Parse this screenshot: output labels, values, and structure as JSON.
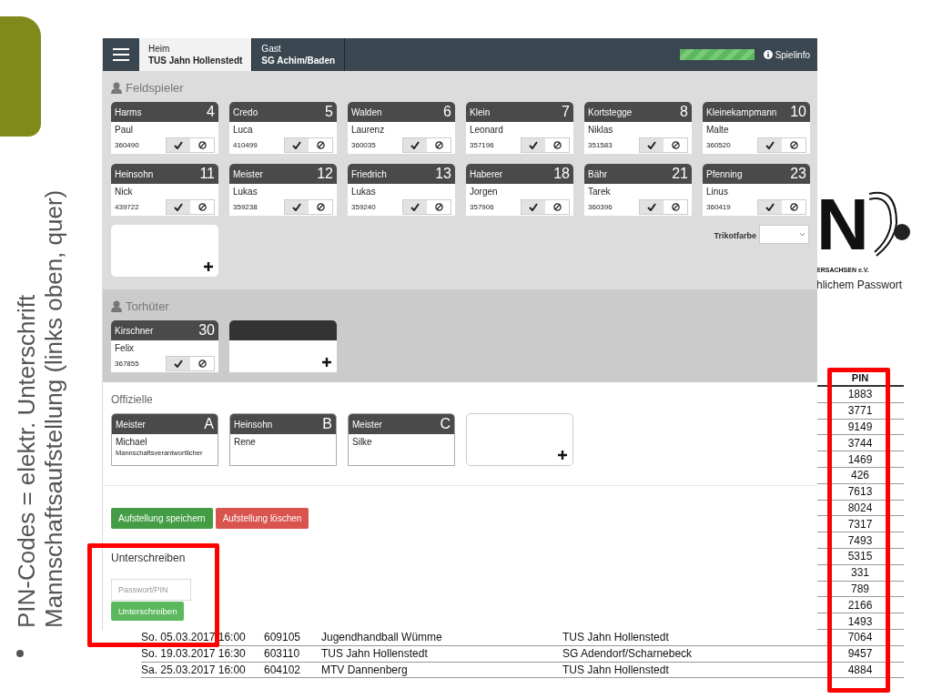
{
  "slide": {
    "bullet": "PIN-Codes = elektr. Unterschrift Mannschaftsaufstellung (links oben, quer)"
  },
  "document": {
    "logo_letter": "N",
    "logo_caption": "ERSACHSEN e.V.",
    "note": "hlichem Passwort",
    "pin_header": "PIN",
    "rows": [
      {
        "pin": "1883"
      },
      {
        "pin": "3771"
      },
      {
        "pin": "9149"
      },
      {
        "pin": "3744"
      },
      {
        "pin": "1469"
      },
      {
        "pin": "426"
      },
      {
        "pin": "7613"
      },
      {
        "pin": "8024"
      },
      {
        "pin": "7317"
      },
      {
        "pin": "7493"
      },
      {
        "pin": "5315"
      },
      {
        "pin": "331"
      },
      {
        "pin": "789"
      },
      {
        "pin": "2166"
      },
      {
        "pin": "1493"
      },
      {
        "date": "So. 05.03.2017 16:00",
        "number": "609105",
        "home": "Jugendhandball Wümme",
        "away": "TUS Jahn Hollenstedt",
        "pin": "7064"
      },
      {
        "date": "So. 19.03.2017 16:30",
        "number": "603110",
        "home": "TUS Jahn Hollenstedt",
        "away": "SG Adendorf/Scharnebeck",
        "pin": "9457"
      },
      {
        "date": "Sa. 25.03.2017 16:00",
        "number": "604102",
        "home": "MTV Dannenberg",
        "away": "TUS Jahn Hollenstedt",
        "pin": "4884"
      }
    ]
  },
  "app": {
    "tabs": [
      {
        "caption": "Heim",
        "team": "TUS Jahn Hollenstedt",
        "selected": true
      },
      {
        "caption": "Gast",
        "team": "SG Achim/Baden",
        "selected": false
      }
    ],
    "progress": {
      "level": 1
    },
    "info_button": "Spielinfo",
    "field_players": {
      "title": "Feldspieler",
      "players": [
        {
          "last": "Harms",
          "number": "4",
          "first": "Paul",
          "id": "360490",
          "checked": true
        },
        {
          "last": "Credo",
          "number": "5",
          "first": "Luca",
          "id": "410499",
          "checked": true
        },
        {
          "last": "Walden",
          "number": "6",
          "first": "Laurenz",
          "id": "360035",
          "checked": true
        },
        {
          "last": "Klein",
          "number": "7",
          "first": "Leonard",
          "id": "357196",
          "checked": true
        },
        {
          "last": "Kortstegge",
          "number": "8",
          "first": "Niklas",
          "id": "351583",
          "checked": true
        },
        {
          "last": "Kleinekampmann",
          "number": "10",
          "first": "Malte",
          "id": "360520",
          "checked": true
        },
        {
          "last": "Heinsohn",
          "number": "11",
          "first": "Nick",
          "id": "439722",
          "checked": true
        },
        {
          "last": "Meister",
          "number": "12",
          "first": "Lukas",
          "id": "359238",
          "checked": true
        },
        {
          "last": "Friedrich",
          "number": "13",
          "first": "Lukas",
          "id": "359240",
          "checked": true
        },
        {
          "last": "Haberer",
          "number": "18",
          "first": "Jorgen",
          "id": "357906",
          "checked": true
        },
        {
          "last": "Bähr",
          "number": "21",
          "first": "Tarek",
          "id": "360396",
          "checked": true
        },
        {
          "last": "Pfenning",
          "number": "23",
          "first": "Linus",
          "id": "360419",
          "checked": true
        }
      ]
    },
    "jersey_label": "Trikotfarbe",
    "goalkeepers": {
      "title": "Torhüter",
      "players": [
        {
          "last": "Kirschner",
          "number": "30",
          "first": "Felix",
          "id": "367855",
          "checked": true
        }
      ]
    },
    "officials": {
      "title": "Offizielle",
      "people": [
        {
          "last": "Meister",
          "letter": "A",
          "first": "Michael",
          "role": "Mannschaftsverantwortlicher"
        },
        {
          "last": "Heinsohn",
          "letter": "B",
          "first": "Rene"
        },
        {
          "last": "Meister",
          "letter": "C",
          "first": "Silke"
        }
      ]
    },
    "buttons": [
      {
        "label": "Aufstellung speichern",
        "kind": "save"
      },
      {
        "label": "Aufstellung löschen",
        "kind": "delete"
      }
    ],
    "sign": {
      "title": "Unterschreiben",
      "placeholder": "Passwort/PIN",
      "button": "Unterschreiben"
    }
  }
}
